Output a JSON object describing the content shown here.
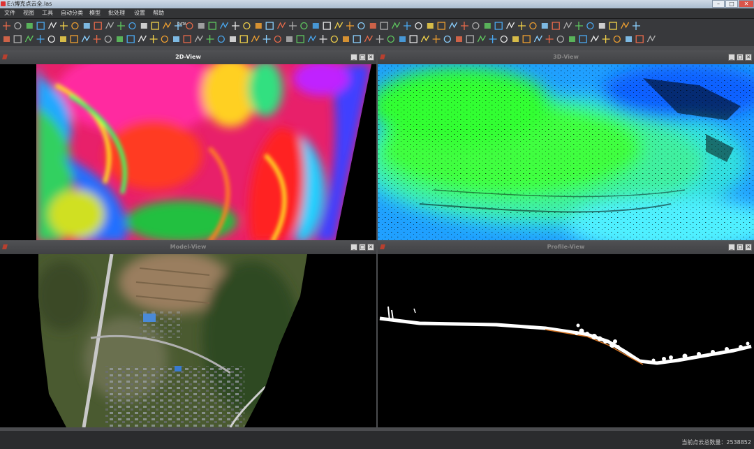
{
  "window": {
    "title": "E:\\博克点云全.las",
    "minimize_glyph": "–",
    "maximize_glyph": "□",
    "close_glyph": "✕"
  },
  "menu": {
    "items": [
      "文件",
      "视图",
      "工具",
      "自动分类",
      "模型",
      "批处理",
      "设置",
      "帮助"
    ]
  },
  "toolbar": {
    "data_label": "DATA"
  },
  "panels": {
    "view2d": {
      "title": "2D-View",
      "active": true
    },
    "view3d": {
      "title": "3D-View",
      "active": false
    },
    "model": {
      "title": "Model-View",
      "active": false
    },
    "profile": {
      "title": "Profile-View",
      "active": false
    },
    "min_glyph": "_",
    "max_glyph": "□",
    "close_glyph": "✕"
  },
  "status": {
    "text": "当前点云总数量：2538852"
  },
  "colors": {
    "accent_red": "#d33333",
    "panel_bg": "#000000",
    "app_bg": "#2a2b2d"
  }
}
